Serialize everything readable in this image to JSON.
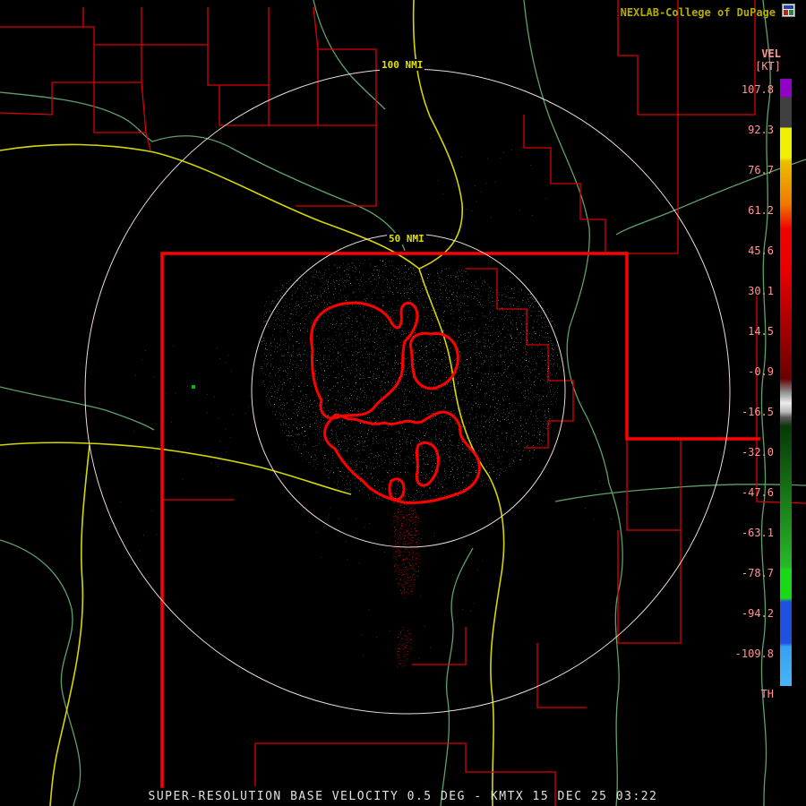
{
  "header": {
    "brand": "NEXLAB-College of DuPage"
  },
  "colorbar": {
    "title": "VEL",
    "units": "[KT]",
    "labels": [
      "107.8",
      "92.3",
      "76.7",
      "61.2",
      "45.6",
      "30.1",
      "14.5",
      "-0.9",
      "-16.5",
      "-32.0",
      "-47.6",
      "-63.1",
      "-78.7",
      "-94.2",
      "-109.8"
    ],
    "threshold_label": "TH"
  },
  "map": {
    "rings": {
      "outer_label": "100 NMI",
      "inner_label": "50 NMI"
    }
  },
  "product": {
    "name": "SUPER-RESOLUTION BASE VELOCITY",
    "elevation": "0.5 DEG",
    "station": "KMTX",
    "datetime": "15 DEC 25 03:22"
  },
  "footer": {
    "caption": "SUPER-RESOLUTION BASE VELOCITY 0.5 DEG - KMTX 15 DEC 25 03:22"
  },
  "colors": {
    "background": "#000000",
    "county_boundary": "#dd0000",
    "state_boundary": "#ff0000",
    "urban_boundary": "#ff0000",
    "highway": "#d6d600",
    "river": "#5fa06a",
    "range_ring": "#eedcdc",
    "echo_gray": "#cfcfcf",
    "echo_red": "#c01010",
    "brand_text": "#b4ac00",
    "scale_label": "#ff9696",
    "ring_label": "#e0e000",
    "caption_text": "#e0e0e0"
  }
}
